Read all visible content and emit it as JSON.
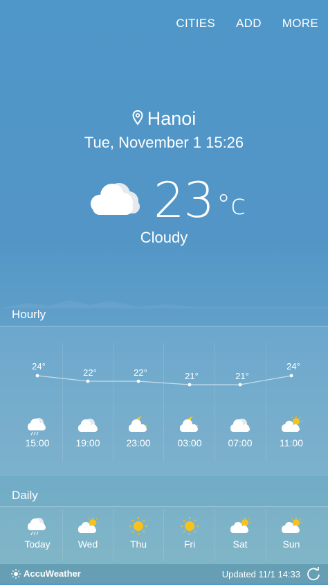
{
  "nav": {
    "cities": "CITIES",
    "add": "ADD",
    "more": "MORE"
  },
  "location": {
    "city": "Hanoi",
    "datetime": "Tue, November 1 15:26"
  },
  "current": {
    "temp": "23",
    "unit": "°c",
    "condition": "Cloudy",
    "icon": "cloudy-icon"
  },
  "hourly": {
    "label": "Hourly",
    "items": [
      {
        "temp": "24°",
        "time": "15:00",
        "icon": "cloud-rain-icon"
      },
      {
        "temp": "22°",
        "time": "19:00",
        "icon": "cloudy-icon"
      },
      {
        "temp": "22°",
        "time": "23:00",
        "icon": "moon-cloud-icon"
      },
      {
        "temp": "21°",
        "time": "03:00",
        "icon": "moon-cloud-icon"
      },
      {
        "temp": "21°",
        "time": "07:00",
        "icon": "cloudy-icon"
      },
      {
        "temp": "24°",
        "time": "11:00",
        "icon": "sun-cloud-icon"
      }
    ]
  },
  "daily": {
    "label": "Daily",
    "items": [
      {
        "day": "Today",
        "icon": "cloud-rain-icon"
      },
      {
        "day": "Wed",
        "icon": "sun-cloud-icon"
      },
      {
        "day": "Thu",
        "icon": "sun-icon"
      },
      {
        "day": "Fri",
        "icon": "sun-icon"
      },
      {
        "day": "Sat",
        "icon": "sun-cloud-icon"
      },
      {
        "day": "Sun",
        "icon": "sun-cloud-icon"
      }
    ]
  },
  "footer": {
    "brand": "AccuWeather",
    "updated": "Updated 11/1  14:33"
  },
  "colors": {
    "sun": "#f7c21c",
    "cloud": "#ffffff",
    "moon": "#f2c624"
  }
}
